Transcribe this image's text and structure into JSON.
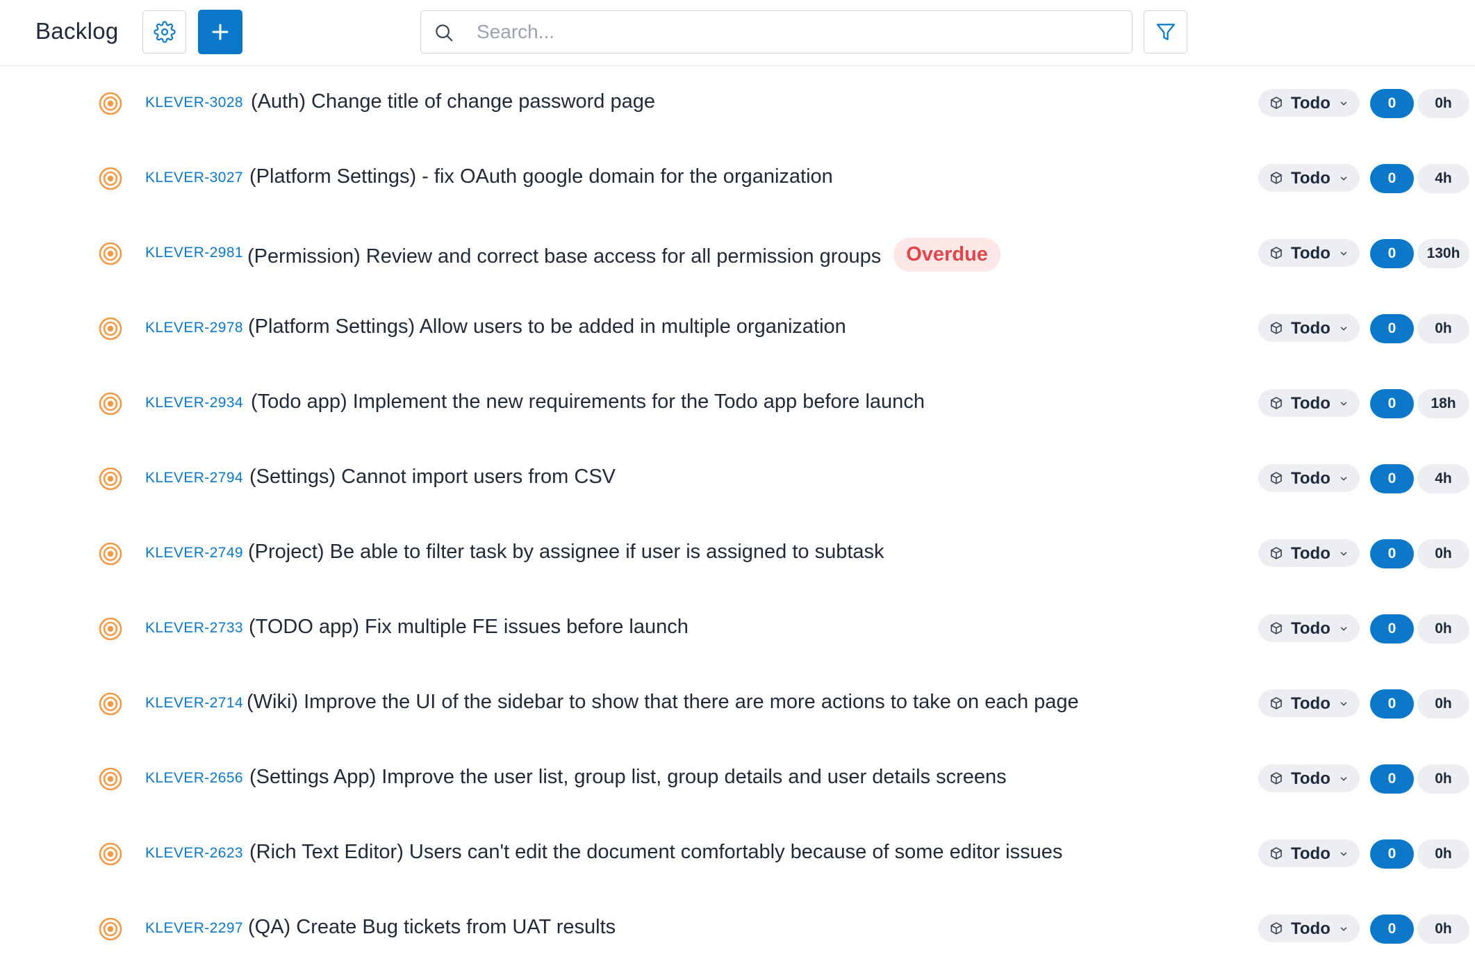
{
  "header": {
    "title": "Backlog",
    "search_placeholder": "Search..."
  },
  "colors": {
    "accent": "#0b78c9",
    "overdue_text": "#e0474c",
    "overdue_bg": "#fde7e7",
    "target_icon": "#f29a45"
  },
  "tasks": [
    {
      "key": "KLEVER-3028",
      "title": "(Auth) Change title of change password page",
      "status": "Todo",
      "count": "0",
      "hours": "0h",
      "overdue": ""
    },
    {
      "key": "KLEVER-3027",
      "title": "(Platform Settings) - fix OAuth google domain for the organization",
      "status": "Todo",
      "count": "0",
      "hours": "4h",
      "overdue": ""
    },
    {
      "key": "KLEVER-2981",
      "title": "(Permission) Review and correct base access for all permission groups",
      "status": "Todo",
      "count": "0",
      "hours": "130h",
      "overdue": "Overdue"
    },
    {
      "key": "KLEVER-2978",
      "title": "(Platform Settings) Allow users to be added in multiple organization",
      "status": "Todo",
      "count": "0",
      "hours": "0h",
      "overdue": ""
    },
    {
      "key": "KLEVER-2934",
      "title": "(Todo app) Implement the new requirements for the Todo app before launch",
      "status": "Todo",
      "count": "0",
      "hours": "18h",
      "overdue": ""
    },
    {
      "key": "KLEVER-2794",
      "title": "(Settings) Cannot import users from CSV",
      "status": "Todo",
      "count": "0",
      "hours": "4h",
      "overdue": ""
    },
    {
      "key": "KLEVER-2749",
      "title": "(Project) Be able to filter task by assignee if user is assigned to subtask",
      "status": "Todo",
      "count": "0",
      "hours": "0h",
      "overdue": ""
    },
    {
      "key": "KLEVER-2733",
      "title": "(TODO app) Fix multiple FE issues before launch",
      "status": "Todo",
      "count": "0",
      "hours": "0h",
      "overdue": ""
    },
    {
      "key": "KLEVER-2714",
      "title": "(Wiki) Improve the UI of the sidebar to show that there are more actions to take on each page",
      "status": "Todo",
      "count": "0",
      "hours": "0h",
      "overdue": ""
    },
    {
      "key": "KLEVER-2656",
      "title": "(Settings App) Improve the user list, group list, group details and user details screens",
      "status": "Todo",
      "count": "0",
      "hours": "0h",
      "overdue": ""
    },
    {
      "key": "KLEVER-2623",
      "title": "(Rich Text Editor) Users can't edit the document comfortably because of some editor issues",
      "status": "Todo",
      "count": "0",
      "hours": "0h",
      "overdue": ""
    },
    {
      "key": "KLEVER-2297",
      "title": "(QA) Create Bug tickets from UAT results",
      "status": "Todo",
      "count": "0",
      "hours": "0h",
      "overdue": ""
    }
  ]
}
